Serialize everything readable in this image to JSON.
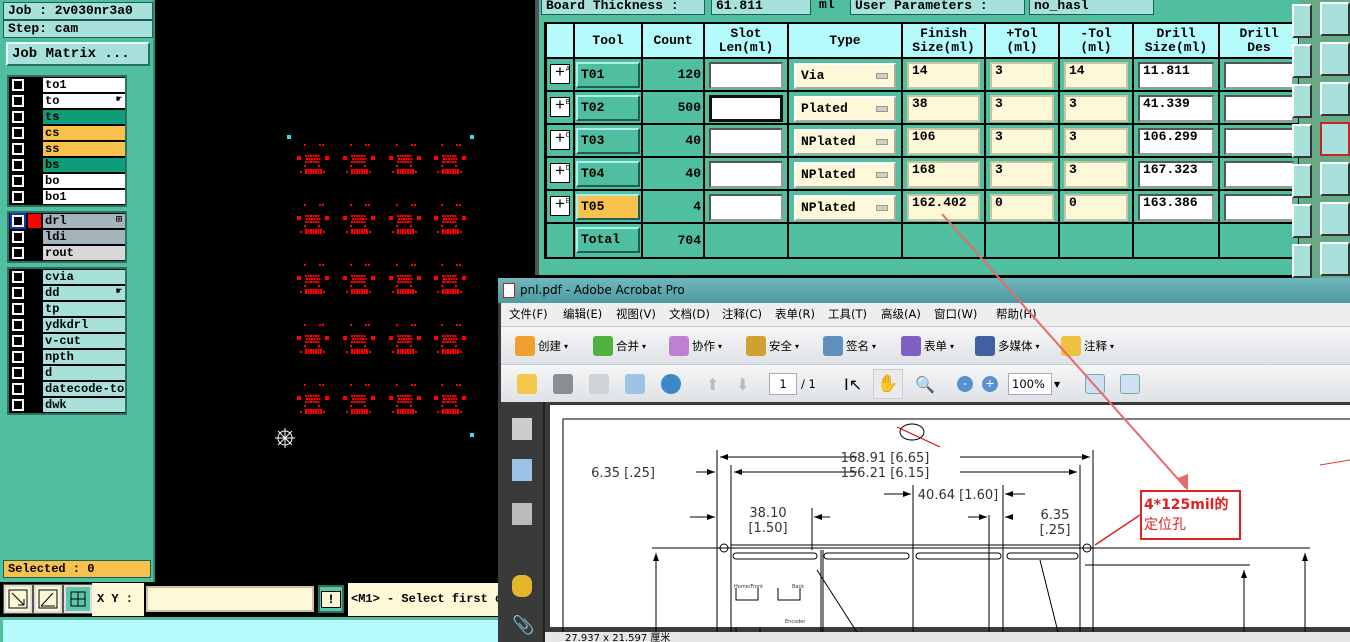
{
  "left_panel": {
    "job_label": "Job : 2v030nr3a0",
    "step_label": "Step: cam",
    "job_matrix_button": "Job Matrix ...",
    "layer_groups": [
      [
        {
          "name": "to1",
          "color": "#ffffff"
        },
        {
          "name": "to",
          "color": "#ffffff",
          "affected": true
        },
        {
          "name": "ts",
          "color": "#0f9c78"
        },
        {
          "name": "cs",
          "color": "#f7c14c"
        },
        {
          "name": "ss",
          "color": "#f7c14c"
        },
        {
          "name": "bs",
          "color": "#0f9c78"
        },
        {
          "name": "bo",
          "color": "#ffffff"
        },
        {
          "name": "bo1",
          "color": "#ffffff"
        }
      ],
      [
        {
          "name": "drl",
          "color": "#a3b4bd",
          "work": true,
          "display_color": "#ff0000"
        },
        {
          "name": "ldi",
          "color": "#a3b4bd"
        },
        {
          "name": "rout",
          "color": "#d8d8d8"
        }
      ],
      [
        {
          "name": "cvia",
          "color": "#a8e0dc"
        },
        {
          "name": "dd",
          "color": "#a8e0dc",
          "affected": true
        },
        {
          "name": "tp",
          "color": "#a8e0dc"
        },
        {
          "name": "ydkdrl",
          "color": "#a8e0dc"
        },
        {
          "name": "v-cut",
          "color": "#a8e0dc"
        },
        {
          "name": "npth",
          "color": "#a8e0dc"
        },
        {
          "name": "d",
          "color": "#a8e0dc"
        },
        {
          "name": "datecode-to",
          "color": "#a8e0dc"
        },
        {
          "name": "dwk",
          "color": "#a8e0dc"
        }
      ]
    ],
    "selected_label": "Selected : 0"
  },
  "bottom_bar": {
    "xy_label": "X Y :",
    "xy_value": "",
    "exclamation": "!",
    "prompt": "<M1> - Select first c"
  },
  "drill_tool_manager": {
    "board_thickness_label": "Board Thickness :",
    "board_thickness_value": "61.811",
    "board_thickness_unit": "ml",
    "user_parameters_label": "User Parameters :",
    "user_parameters_value": "no_hasl",
    "columns": [
      "",
      "Tool",
      "Count",
      "Slot\nLen(ml)",
      "Type",
      "Finish\nSize(ml)",
      "+Tol\n(ml)",
      "-Tol\n(ml)",
      "Drill\nSize(ml)",
      "Drill\nDes"
    ],
    "rows": [
      {
        "letter": "A",
        "tool": "T01",
        "count": "120",
        "slot_len": "",
        "type": "Via",
        "finish": "14",
        "ptol": "3",
        "ntol": "14",
        "drill": "11.811",
        "des": ""
      },
      {
        "letter": "B",
        "tool": "T02",
        "count": "500",
        "slot_len": "",
        "type": "Plated",
        "finish": "38",
        "ptol": "3",
        "ntol": "3",
        "drill": "41.339",
        "des": ""
      },
      {
        "letter": "C",
        "tool": "T03",
        "count": "40",
        "slot_len": "",
        "type": "NPlated",
        "finish": "106",
        "ptol": "3",
        "ntol": "3",
        "drill": "106.299",
        "des": ""
      },
      {
        "letter": "D",
        "tool": "T04",
        "count": "40",
        "slot_len": "",
        "type": "NPlated",
        "finish": "168",
        "ptol": "3",
        "ntol": "3",
        "drill": "167.323",
        "des": ""
      },
      {
        "letter": "E",
        "tool": "T05",
        "count": "4",
        "slot_len": "",
        "type": "NPlated",
        "finish": "162.402",
        "ptol": "0",
        "ntol": "0",
        "drill": "163.386",
        "des": "",
        "highlight": true
      }
    ],
    "total_label": "Total",
    "total_count": "704"
  },
  "acrobat": {
    "title": "pnl.pdf - Adobe Acrobat Pro",
    "menu": [
      "文件(F)",
      "编辑(E)",
      "视图(V)",
      "文档(D)",
      "注释(C)",
      "表单(R)",
      "工具(T)",
      "高级(A)",
      "窗口(W)",
      "帮助(H)"
    ],
    "toolbar": [
      {
        "icon": "create-icon",
        "label": "创建"
      },
      {
        "icon": "combine-icon",
        "label": "合并"
      },
      {
        "icon": "collaborate-icon",
        "label": "协作"
      },
      {
        "icon": "lock-icon",
        "label": "安全"
      },
      {
        "icon": "pen-icon",
        "label": "签名"
      },
      {
        "icon": "form-icon",
        "label": "表单"
      },
      {
        "icon": "multimedia-icon",
        "label": "多媒体"
      },
      {
        "icon": "comment-icon",
        "label": "注释"
      }
    ],
    "page_current": "1",
    "page_total": "/ 1",
    "zoom": "100%",
    "status": "27.937 x 21.597 厘米",
    "drawing": {
      "dim_overall": "168.91 [6.65]",
      "dim_inner": "156.21 [6.15]",
      "dim_left_edge": "6.35 [.25]",
      "dim_pitch": "40.64 [1.60]",
      "dim_first": "38.10",
      "dim_first_in": "[1.50]",
      "dim_right_edge": "6.35",
      "dim_right_edge_in": "[.25]",
      "label_home": "Home/Front",
      "label_back": "Back",
      "label_encoder": "Encoder",
      "annotation": [
        "4*125mil的",
        "定位孔"
      ]
    }
  },
  "colors": {
    "panel_teal": "#4fbf9f",
    "drill_red": "#ff0000",
    "highlight_orange": "#f7c14c",
    "annotation_red": "#e02020"
  }
}
